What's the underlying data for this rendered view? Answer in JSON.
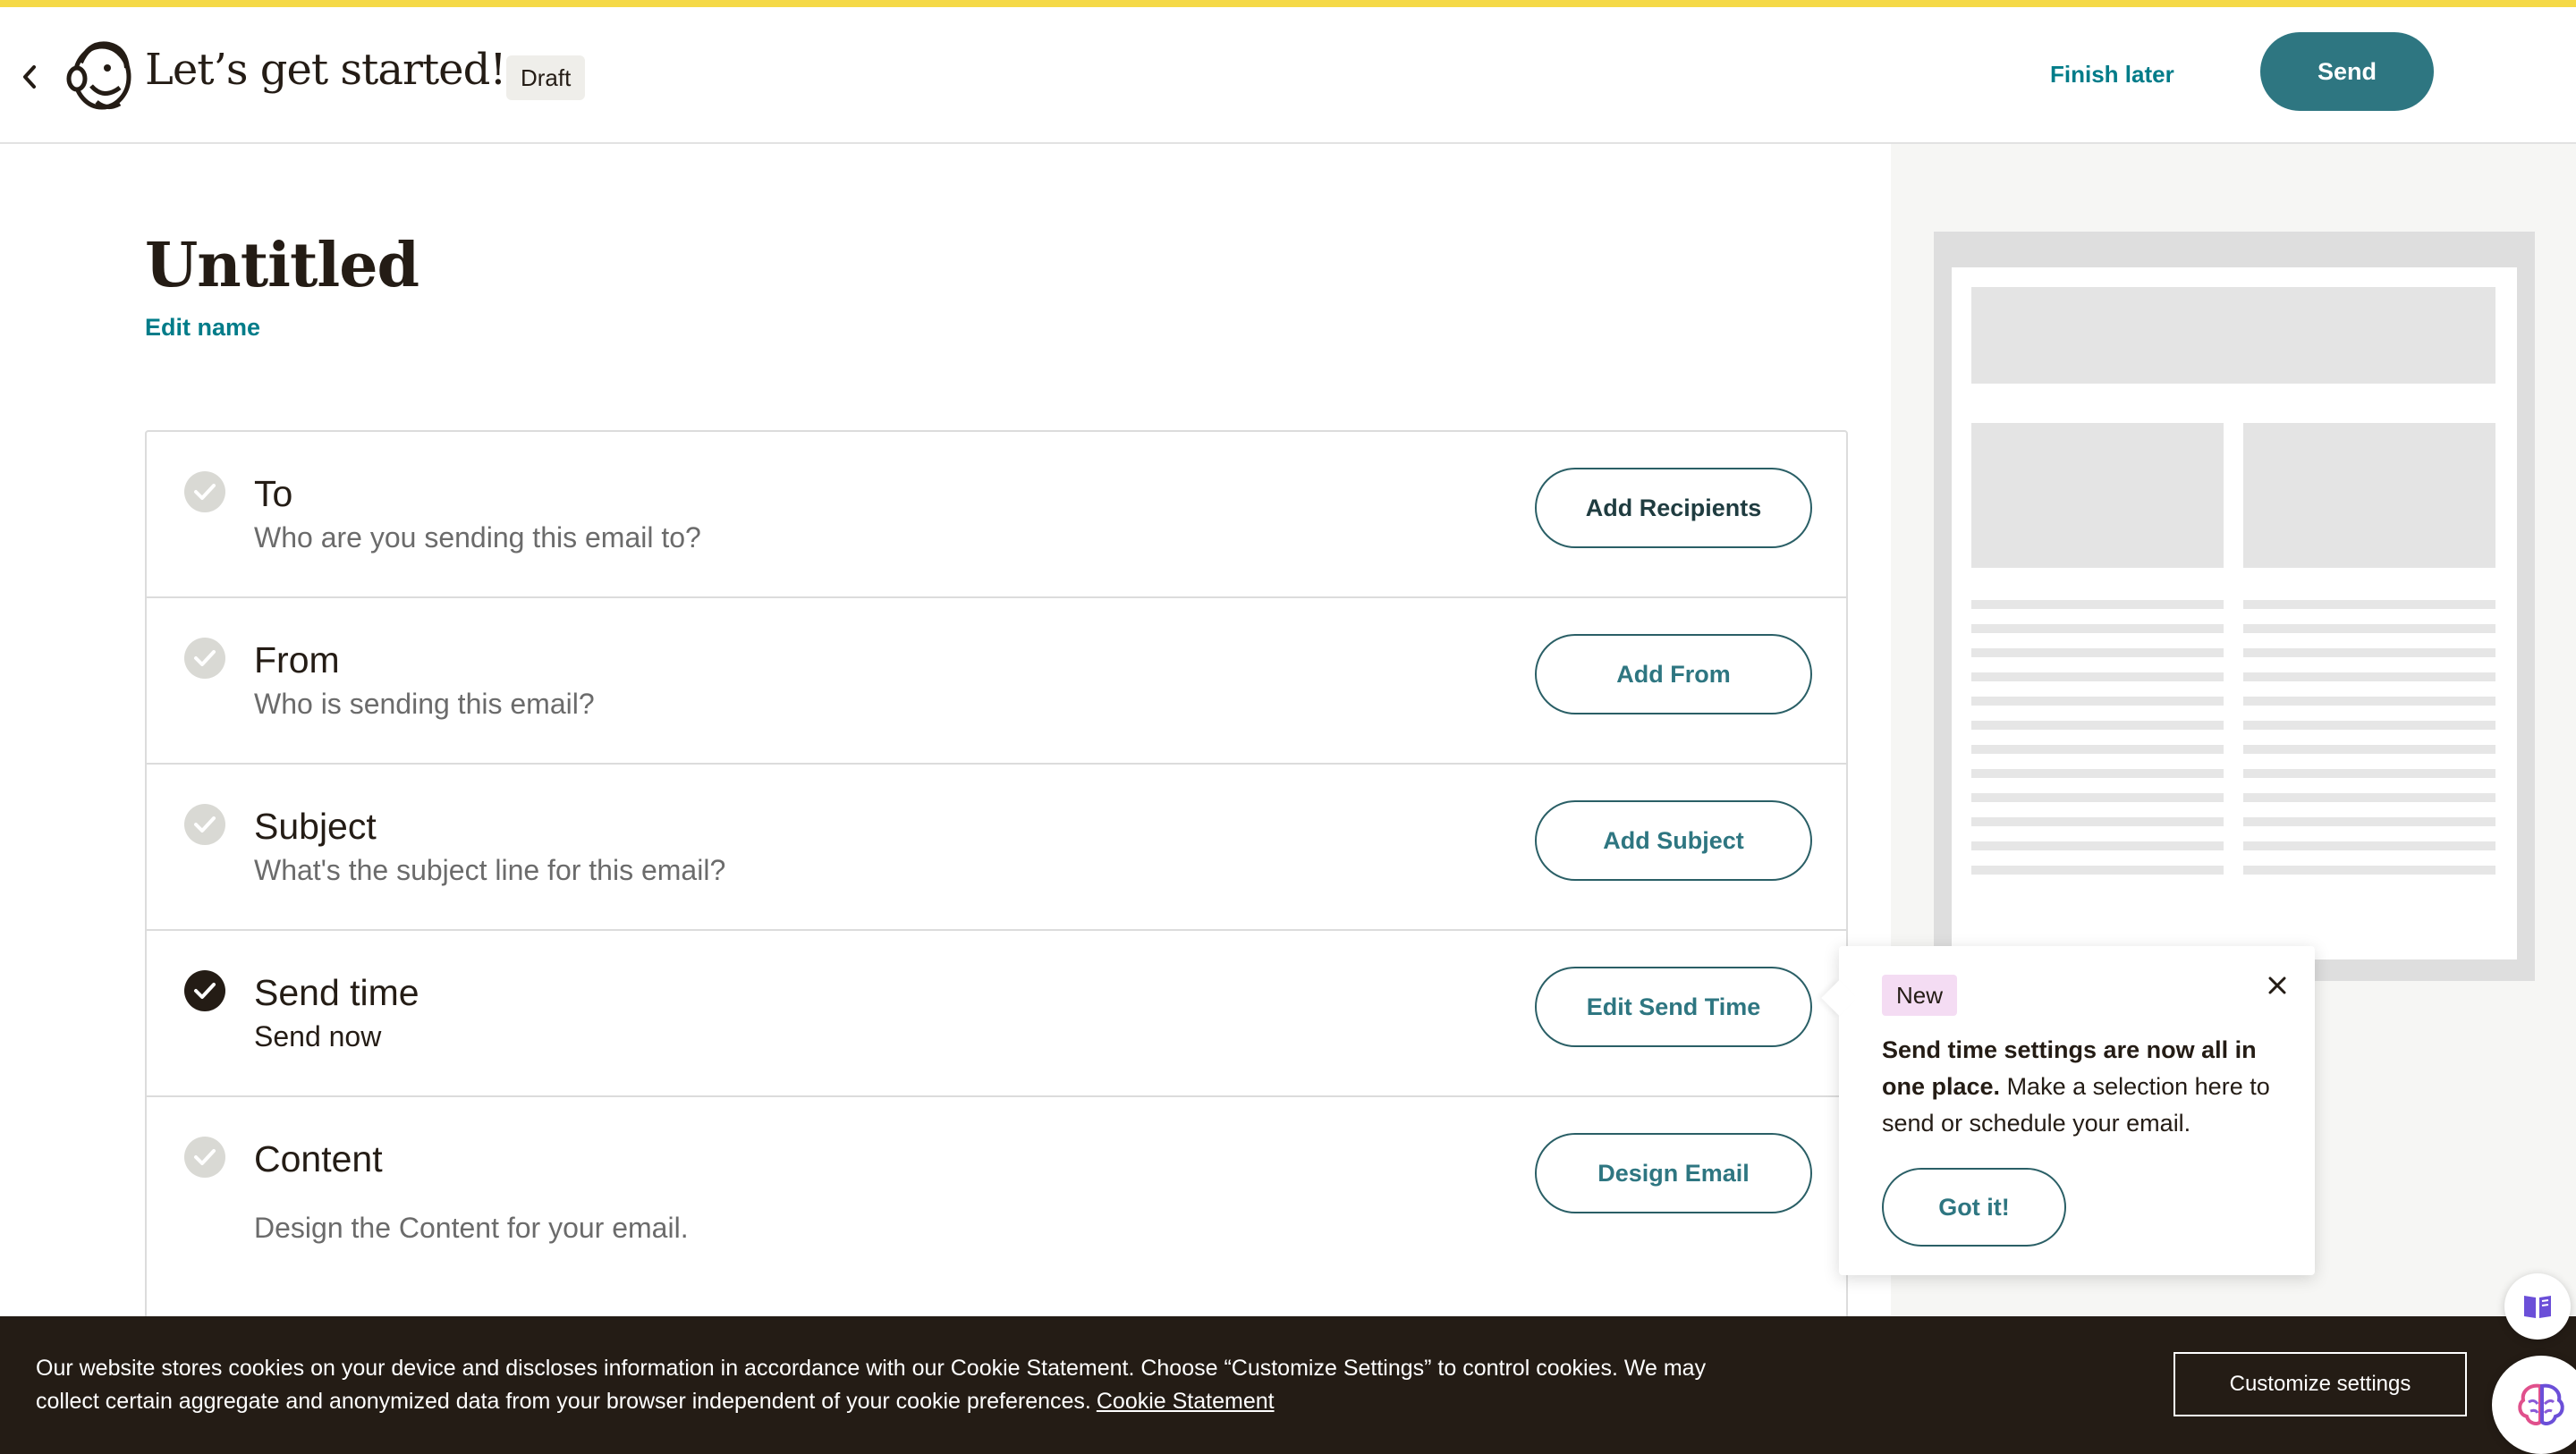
{
  "header": {
    "app_title": "Let’s get started!",
    "status_badge": "Draft",
    "finish_later": "Finish later",
    "send": "Send"
  },
  "campaign": {
    "title": "Untitled",
    "edit_name": "Edit name"
  },
  "checklist": [
    {
      "title": "To",
      "subtitle": "Who are you sending this email to?",
      "button": "Add Recipients",
      "done": false
    },
    {
      "title": "From",
      "subtitle": "Who is sending this email?",
      "button": "Add From",
      "done": false
    },
    {
      "title": "Subject",
      "subtitle": "What's the subject line for this email?",
      "button": "Add Subject",
      "done": false
    },
    {
      "title": "Send time",
      "subtitle": "Send now",
      "button": "Edit Send Time",
      "done": true
    },
    {
      "title": "Content",
      "subtitle": "Design the Content for your email.",
      "button": "Design Email",
      "done": false
    }
  ],
  "popover": {
    "badge": "New",
    "bold_text": "Send time settings are now all in one place.",
    "text": "Make a selection here to send or schedule your email.",
    "button": "Got it!"
  },
  "cookie_banner": {
    "text": "Our website stores cookies on your device and discloses information in accordance with our Cookie Statement. Choose “Customize Settings” to control cookies. We may collect certain aggregate and anonymized data from your browser independent of your cookie preferences.",
    "link": "Cookie Statement",
    "button": "Customize settings"
  },
  "icons": {
    "back": "chevron-left-icon",
    "logo": "mailchimp-logo-icon",
    "check": "check-icon",
    "close": "close-icon",
    "book": "book-icon",
    "assistant": "brain-icon"
  },
  "colors": {
    "accent": "#007c89",
    "send_button": "#2e7681",
    "top_stripe": "#f5d947",
    "badge_new": "#f4dcf3",
    "cookie_bg": "#241c15"
  }
}
